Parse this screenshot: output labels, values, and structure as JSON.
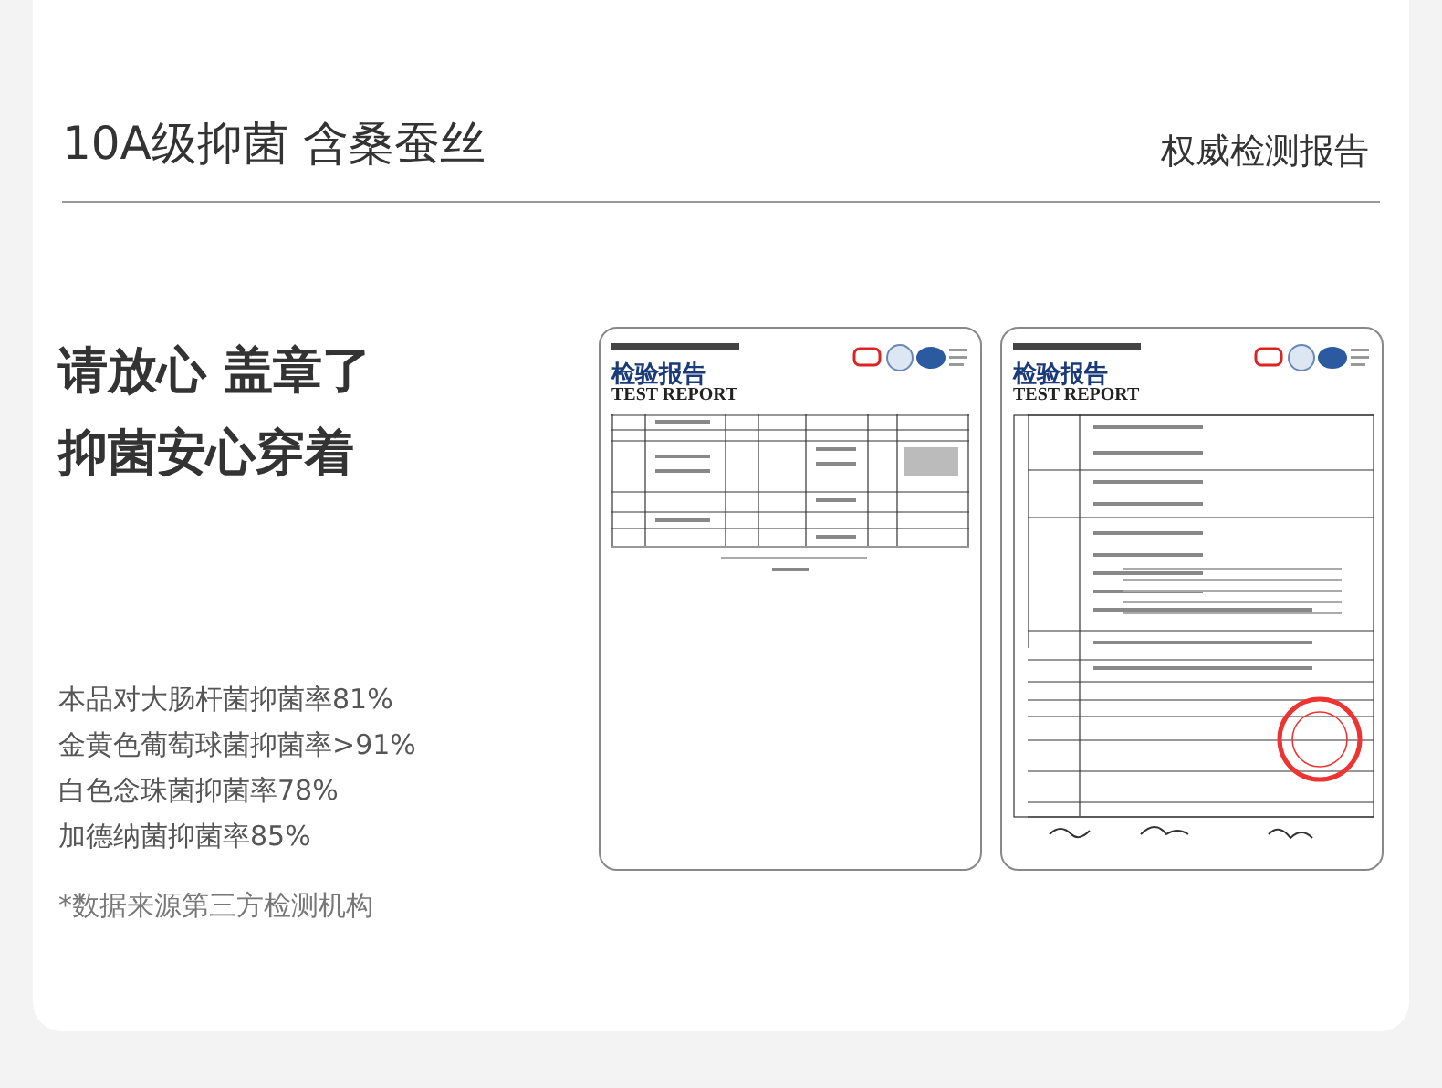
{
  "header": {
    "title": "10A级抑菌 含桑蚕丝",
    "subtitle": "权威检测报告"
  },
  "headline": [
    "请放心 盖章了",
    "抑菌安心穿着"
  ],
  "results": [
    "本品对大肠杆菌抑菌率81%",
    "金黄色葡萄球菌抑菌率>91%",
    "白色念珠菌抑菌率78%",
    "加德纳菌抑菌率85%"
  ],
  "footnote": "*数据来源第三方检测机构",
  "reports": [
    {
      "kind": "summary",
      "heading": "检验报告",
      "heading_en": "TEST REPORT"
    },
    {
      "kind": "cover",
      "heading": "检验报告",
      "heading_en": "TEST REPORT"
    }
  ]
}
